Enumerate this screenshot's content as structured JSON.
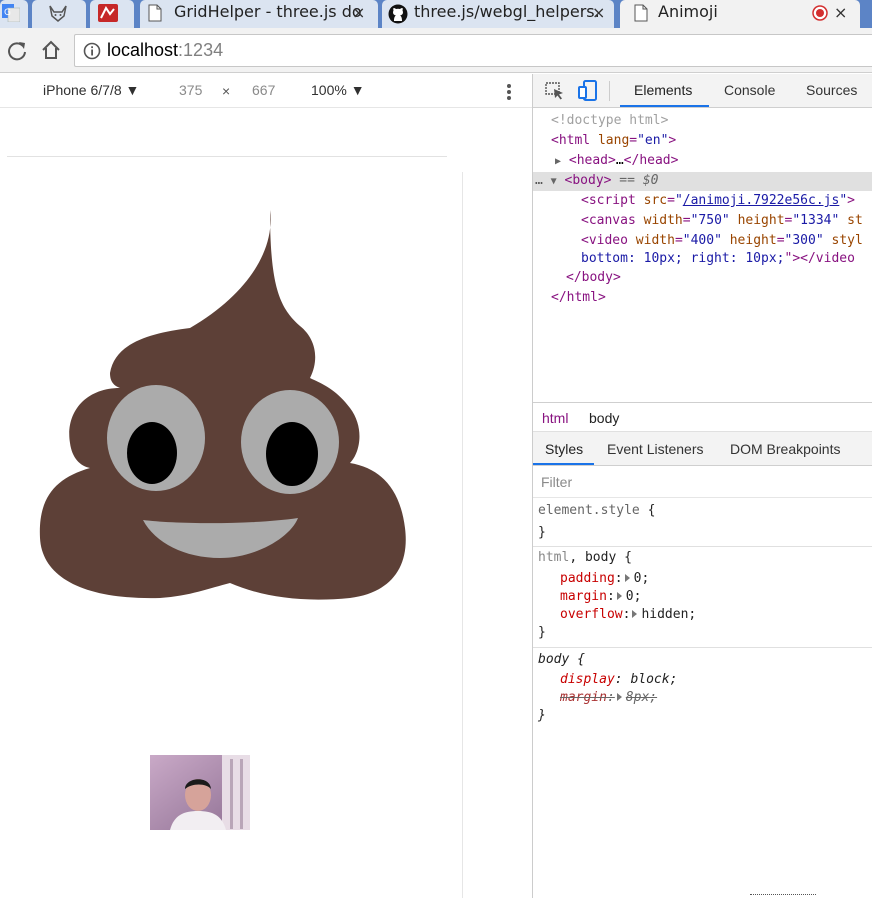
{
  "browser": {
    "tabs": [
      {
        "title": "",
        "icon": "google-translate-icon"
      },
      {
        "title": "",
        "icon": "fox-icon"
      },
      {
        "title": "",
        "icon": "red-app-icon"
      },
      {
        "title": "GridHelper - three.js do",
        "icon": "document-icon"
      },
      {
        "title": "three.js/webgl_helpers.",
        "icon": "github-icon"
      },
      {
        "title": "Animoji",
        "icon": "document-icon"
      }
    ],
    "close_glyph": "×",
    "url_host": "localhost",
    "url_port": ":1234"
  },
  "device_toolbar": {
    "device": "iPhone 6/7/8",
    "width": "375",
    "times": "×",
    "height": "667",
    "zoom": "100%"
  },
  "devtools": {
    "tabs": [
      "Elements",
      "Console",
      "Sources"
    ],
    "dom": {
      "doctype": "<!doctype html>",
      "html_open_tag": "html",
      "html_attr": "lang",
      "html_val": "\"en\"",
      "head_tag": "head",
      "ellipsis": "…",
      "body_tag": "body",
      "body_marker": " == $0",
      "script_tag": "script",
      "script_attr": "src",
      "script_src": "/animoji.7922e56c.js",
      "canvas_tag": "canvas",
      "canvas_width_attr": "width",
      "canvas_width": "\"750\"",
      "canvas_height_attr": "height",
      "canvas_height": "\"1334\"",
      "canvas_trail": "st",
      "video_tag": "video",
      "video_width_attr": "width",
      "video_width": "\"400\"",
      "video_height_attr": "height",
      "video_height": "\"300\"",
      "video_trail": "styl",
      "video_style_cont": "bottom: 10px; right: 10px;",
      "video_close": "\"></video",
      "body_close": "</body>",
      "html_close": "</html>"
    },
    "breadcrumbs": [
      "html",
      "body"
    ],
    "styles_tabs": [
      "Styles",
      "Event Listeners",
      "DOM Breakpoints"
    ],
    "filter_placeholder": "Filter",
    "rules": {
      "element_style": "element.style",
      "rule2_selector_a": "html",
      "rule2_selector_b": ", body",
      "rule2_props": [
        {
          "name": "padding",
          "value": "0;"
        },
        {
          "name": "margin",
          "value": "0;"
        },
        {
          "name": "overflow",
          "value": "hidden;"
        }
      ],
      "rule3_selector": "body",
      "rule3_prop1_name": "display",
      "rule3_prop1_value": "block;",
      "rule3_prop2_name": "margin",
      "rule3_prop2_value": "8px;"
    }
  },
  "colors": {
    "poop": "#5d4037",
    "eye_white": "#ababab",
    "pupil": "#000000",
    "mouth": "#ababab",
    "tab_bar": "#5c84c6"
  }
}
